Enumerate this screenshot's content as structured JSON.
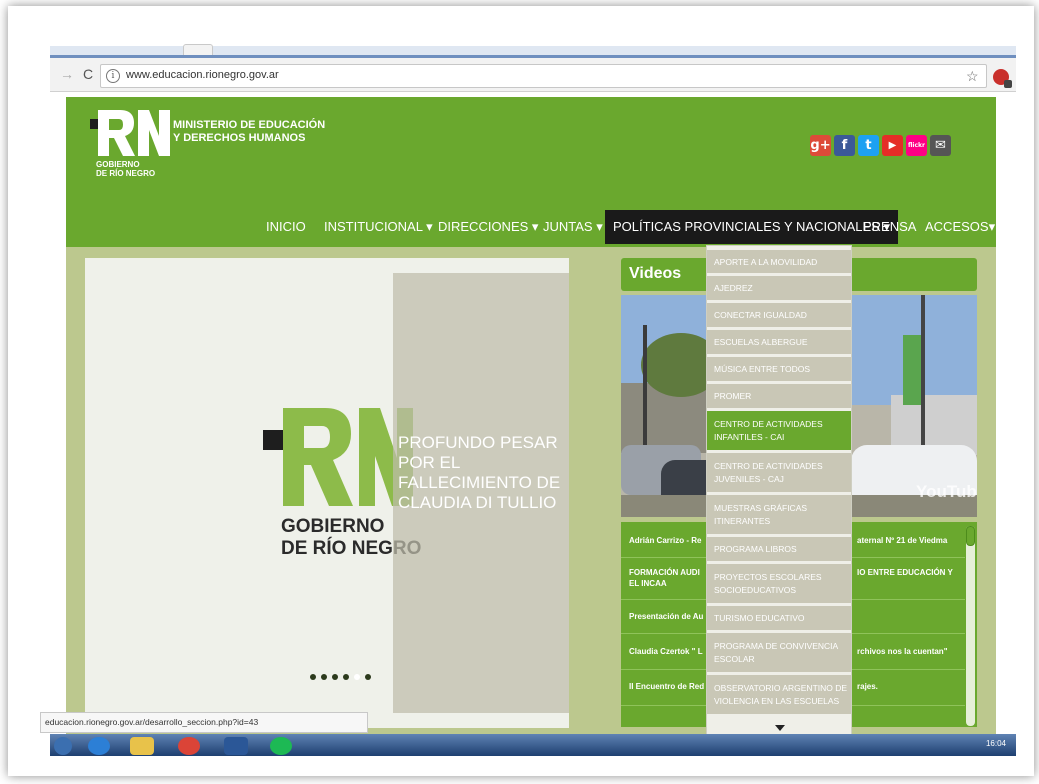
{
  "browser": {
    "url": "www.educacion.rionegro.gov.ar",
    "status_url": "educacion.rionegro.gov.ar/desarrollo_seccion.php?id=43",
    "clock": "16:04",
    "nav_forward": "→",
    "nav_reload": "C",
    "info_glyph": "i",
    "star_glyph": "☆"
  },
  "header": {
    "logo_text": "RN",
    "ministry_line1": "MINISTERIO DE EDUCACIÓN",
    "ministry_line2": "Y DERECHOS HUMANOS",
    "gobierno_line1": "GOBIERNO",
    "gobierno_line2": "DE RÍO NEGRO"
  },
  "social": [
    {
      "name": "googleplus",
      "label": "g+",
      "color": "#dd4b39"
    },
    {
      "name": "facebook",
      "label": "f",
      "color": "#3b5998"
    },
    {
      "name": "twitter",
      "label": "t",
      "color": "#1da1f2"
    },
    {
      "name": "youtube",
      "label": "▶",
      "color": "#e52d27"
    },
    {
      "name": "flickr",
      "label": "flickr",
      "color": "#ff0084"
    },
    {
      "name": "email",
      "label": "✉",
      "color": "#555555"
    }
  ],
  "menu": {
    "inicio": "INICIO",
    "institucional": "INSTITUCIONAL ▾",
    "direcciones": "DIRECCIONES ▾",
    "juntas": "JUNTAS ▾",
    "politicas": "POLÍTICAS PROVINCIALES Y NACIONALES ▾",
    "prensa": "PRENSA",
    "accesos": "ACCESOS▾"
  },
  "slider": {
    "gobierno_line1": "GOBIERNO",
    "gobierno_line2": "DE RÍO NEGRO",
    "pesar": "PROFUNDO PESAR POR EL FALLECIMIENTO DE CLAUDIA DI TULLIO"
  },
  "videos": {
    "title": "Videos",
    "watermark": "YouTube",
    "items": [
      {
        "left": "Adrián Carrizo - Re",
        "right": "aternal Nº 21 de Viedma"
      },
      {
        "left": "FORMACIÓN AUDI",
        "left2": "EL INCAA",
        "right": "IO ENTRE EDUCACIÓN Y"
      },
      {
        "left": "Presentación de Au",
        "right": ""
      },
      {
        "left": "Claudia Czertok \" L",
        "right": "rchivos nos la cuentan\""
      },
      {
        "left": "II Encuentro de Red",
        "right": "rajes."
      }
    ]
  },
  "dropdown": [
    "APORTE A LA MOVILIDAD",
    "AJEDREZ",
    "CONECTAR IGUALDAD",
    "ESCUELAS ALBERGUE",
    "MÚSICA ENTRE TODOS",
    "PROMER",
    "CENTRO DE ACTIVIDADES INFANTILES - CAI",
    "CENTRO DE ACTIVIDADES JUVENILES - CAJ",
    "MUESTRAS GRÁFICAS ITINERANTES",
    "PROGRAMA LIBROS",
    "PROYECTOS ESCOLARES SOCIOEDUCATIVOS",
    "TURISMO EDUCATIVO",
    "PROGRAMA DE CONVIVENCIA ESCOLAR",
    "OBSERVATORIO ARGENTINO DE VIOLENCIA EN LAS ESCUELAS"
  ],
  "colors": {
    "brand_green": "#6aa82e",
    "menu_active": "#1a1a1a",
    "dropdown_item": "#c9c7b6"
  }
}
